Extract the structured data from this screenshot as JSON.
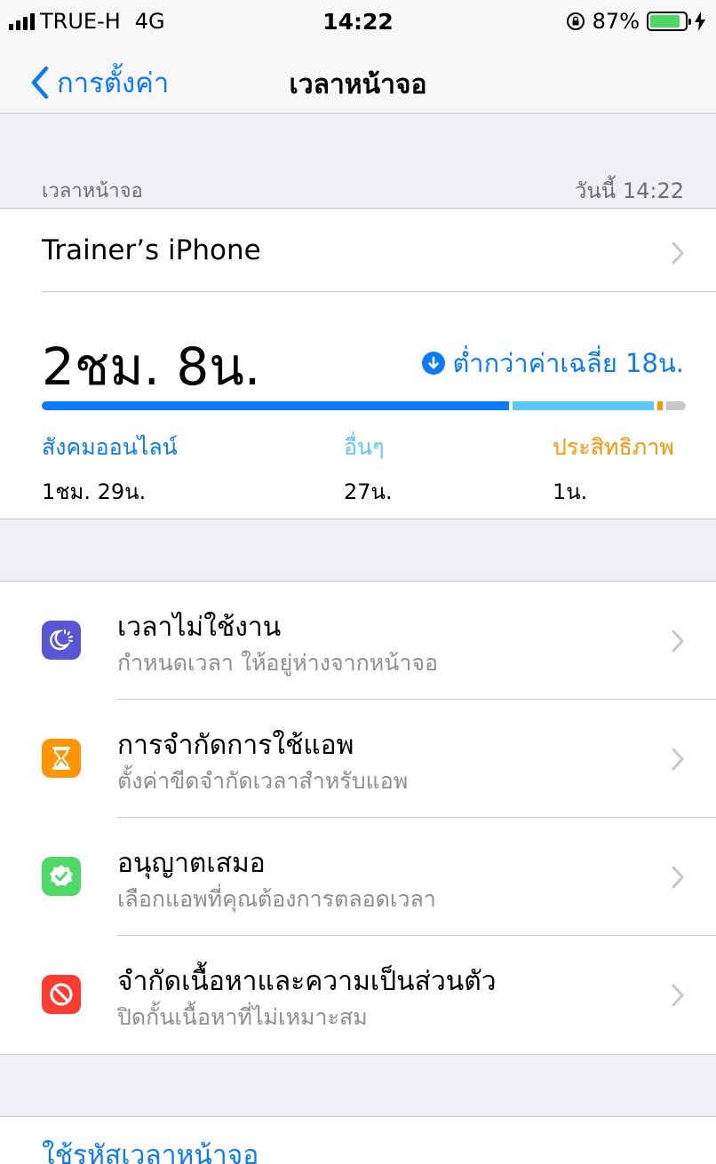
{
  "status_bar": {
    "carrier": "TRUE-H",
    "network": "4G",
    "time": "14:22",
    "battery_percent": "87%",
    "battery_level": 0.87
  },
  "nav": {
    "back_label": "การตั้งค่า",
    "title": "เวลาหน้าจอ"
  },
  "summary": {
    "section_label": "เวลาหน้าจอ",
    "date_label": "วันนี้ 14:22",
    "device_name": "Trainer’s iPhone",
    "total_time": "2ชม. 8น.",
    "average_note": "ต่ำกว่าค่าเฉลี่ย 18น.",
    "categories": [
      {
        "label": "สังคมออนไลน์",
        "value": "1ชม. 29น.",
        "color": "#0a7aff",
        "minutes": 89
      },
      {
        "label": "อื่นๆ",
        "value": "27น.",
        "color": "#5ac8fa",
        "minutes": 27
      },
      {
        "label": "ประสิทธิภาพ",
        "value": "1น.",
        "color": "#ff9500",
        "minutes": 1
      }
    ],
    "remainder_color": "#c7c7cc"
  },
  "options": [
    {
      "title": "เวลาไม่ใช้งาน",
      "subtitle": "กำหนดเวลา ให้อยู่ห่างจากหน้าจอ",
      "icon": "downtime-icon",
      "color": "#5856d6"
    },
    {
      "title": "การจำกัดการใช้แอพ",
      "subtitle": "ตั้งค่าขีดจำกัดเวลาสำหรับแอพ",
      "icon": "hourglass-icon",
      "color": "#ff9500"
    },
    {
      "title": "อนุญาตเสมอ",
      "subtitle": "เลือกแอพที่คุณต้องการตลอดเวลา",
      "icon": "checkmark-badge-icon",
      "color": "#4cd964"
    },
    {
      "title": "จำกัดเนื้อหาและความเป็นส่วนตัว",
      "subtitle": "ปิดกั้นเนื้อหาที่ไม่เหมาะสม",
      "icon": "restriction-icon",
      "color": "#ff3b30"
    }
  ],
  "passcode": {
    "label": "ใช้รหัสเวลาหน้าจอ"
  }
}
